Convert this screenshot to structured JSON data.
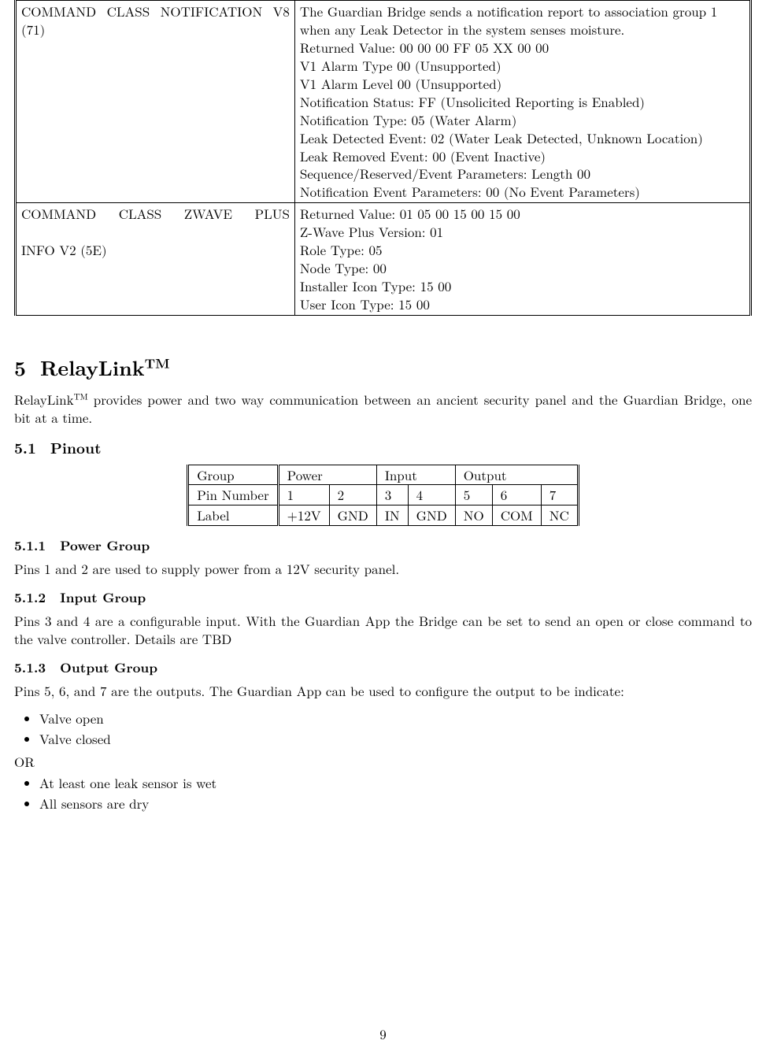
{
  "cmd_table": {
    "rows": [
      {
        "name": "COMMAND CLASS NOTIFICATION V8 (71)",
        "lines": [
          "The Guardian Bridge sends a notification report to association group 1 when any Leak Detector in the system senses moisture.",
          "Returned Value: 00 00 00 FF 05 XX 00 00",
          "V1 Alarm Type 00 (Unsupported)",
          "V1 Alarm Level 00 (Unsupported)",
          "Notification Status: FF (Unsolicited Reporting is Enabled)",
          "Notification Type: 05 (Water Alarm)",
          "Leak Detected Event: 02 (Water Leak Detected, Unknown Location)",
          "Leak Removed Event: 00 (Event Inactive)",
          "Sequence/Reserved/Event Parameters: Length 00",
          "Notification Event Parameters: 00 (No Event Parameters)"
        ]
      },
      {
        "name_line1": "COMMAND CLASS ZWAVE PLUS",
        "name_line2": "INFO V2 (5E)",
        "lines": [
          "Returned Value: 01 05 00 15 00 15 00",
          "Z-Wave Plus Version: 01",
          "Role Type: 05",
          "Node Type: 00",
          "Installer Icon Type: 15 00",
          "User Icon Type: 15 00"
        ]
      }
    ]
  },
  "sec5": {
    "num": "5",
    "title_main": "RelayLink",
    "title_tm": "TM",
    "intro_a": "RelayLink",
    "intro_b": " provides power and two way communication between an ancient security panel and the Guardian Bridge, one bit at a time."
  },
  "sec51": {
    "num": "5.1",
    "title": "Pinout",
    "table": {
      "group_label": "Group",
      "groups": [
        "Power",
        "Input",
        "Output"
      ],
      "pin_label": "Pin Number",
      "pins": [
        "1",
        "2",
        "3",
        "4",
        "5",
        "6",
        "7"
      ],
      "label_label": "Label",
      "labels": [
        "+12V",
        "GND",
        "IN",
        "GND",
        "NO",
        "COM",
        "NC"
      ]
    }
  },
  "sec511": {
    "num": "5.1.1",
    "title": "Power Group",
    "text": "Pins 1 and 2 are used to supply power from a 12V security panel."
  },
  "sec512": {
    "num": "5.1.2",
    "title": "Input Group",
    "text": "Pins 3 and 4 are a configurable input. With the Guardian App the Bridge can be set to send an open or close command to the valve controller. Details are TBD"
  },
  "sec513": {
    "num": "5.1.3",
    "title": "Output Group",
    "text": "Pins 5, 6, and 7 are the outputs. The Guardian App can be used to configure the output to be indicate:",
    "bullets_a": [
      "Valve open",
      "Valve closed"
    ],
    "or": "OR",
    "bullets_b": [
      "At least one leak sensor is wet",
      "All sensors are dry"
    ]
  },
  "page_number": "9"
}
